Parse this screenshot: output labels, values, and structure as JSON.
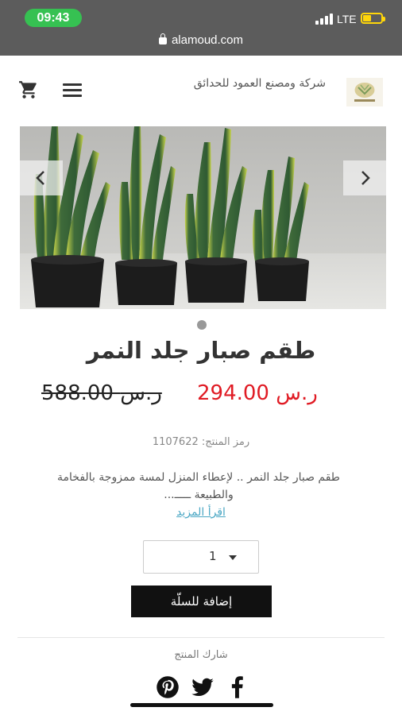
{
  "status_bar": {
    "time": "09:43",
    "network": "LTE",
    "url": "alamoud.com",
    "accent": "#36c152",
    "battery_color": "#ffd60a"
  },
  "header": {
    "brand_name": "شركة ومصنع العمود للحدائق",
    "icons": [
      "cart-icon",
      "menu-icon",
      "logo"
    ]
  },
  "slider": {
    "prev_icon": "chevron-left-icon",
    "next_icon": "chevron-right-icon"
  },
  "product": {
    "title": "طقم صبار جلد النمر",
    "price_new": "294.00 ر.س",
    "price_old": "588.00 ر.س",
    "price_color": "#e01b24",
    "sku_label": "رمز المنتج: 1107622",
    "description": "طقم صبار جلد النمر .. لإعطاء المنزل لمسة ممزوجة بالفخامة والطبيعة ـــــ...",
    "read_more": "اقرأ المزيد",
    "quantity": "1",
    "add_to_cart": "إضافة للسلّة"
  },
  "share": {
    "label": "شارك المنتج",
    "icons": [
      "facebook-icon",
      "twitter-icon",
      "pinterest-icon"
    ]
  }
}
